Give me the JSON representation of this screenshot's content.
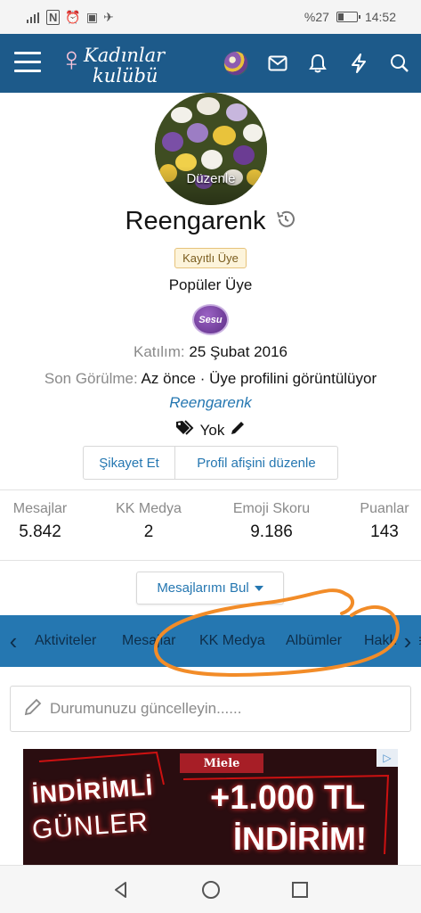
{
  "status_bar": {
    "battery": "%27",
    "battery_level": 0.27,
    "time": "14:52"
  },
  "header": {
    "logo_line1": "Kadınlar",
    "logo_line2": "kulübü",
    "icons": [
      "menu-icon",
      "avatar-icon",
      "mail-icon",
      "bell-icon",
      "bolt-icon",
      "search-icon"
    ],
    "brand_color": "#1d5a8a"
  },
  "profile": {
    "avatar_edit_label": "Düzenle",
    "username": "Reengarenk",
    "badge": "Kayıtlı Üye",
    "user_title": "Popüler Üye",
    "banner_text": "Sesu",
    "joined_label": "Katılım:",
    "joined_value": "25 Şubat 2016",
    "last_seen_label": "Son Görülme:",
    "last_seen_value": "Az önce · Üye profilini görüntülüyor",
    "signature_name": "Reengarenk",
    "tag_value": "Yok",
    "report_button": "Şikayet Et",
    "edit_banner_button": "Profil afişini düzenle"
  },
  "stats": [
    {
      "label": "Mesajlar",
      "value": "5.842"
    },
    {
      "label": "KK Medya",
      "value": "2"
    },
    {
      "label": "Emoji Skoru",
      "value": "9.186"
    },
    {
      "label": "Puanlar",
      "value": "143"
    }
  ],
  "find_messages_button": "Mesajlarımı Bul",
  "tabs": [
    "Aktiviteler",
    "Mesajlar",
    "KK Medya",
    "Albümler",
    "Hakkında"
  ],
  "status_input": {
    "placeholder": "Durumunuzu güncelleyin......"
  },
  "ad": {
    "brand": "Miele",
    "line1": "İNDİRİMLİ",
    "line2": "GÜNLER",
    "line3": "+1.000 TL",
    "line4": "İNDİRİM!"
  },
  "accent_color": "#2577b1",
  "annotation_color": "#f28c28"
}
